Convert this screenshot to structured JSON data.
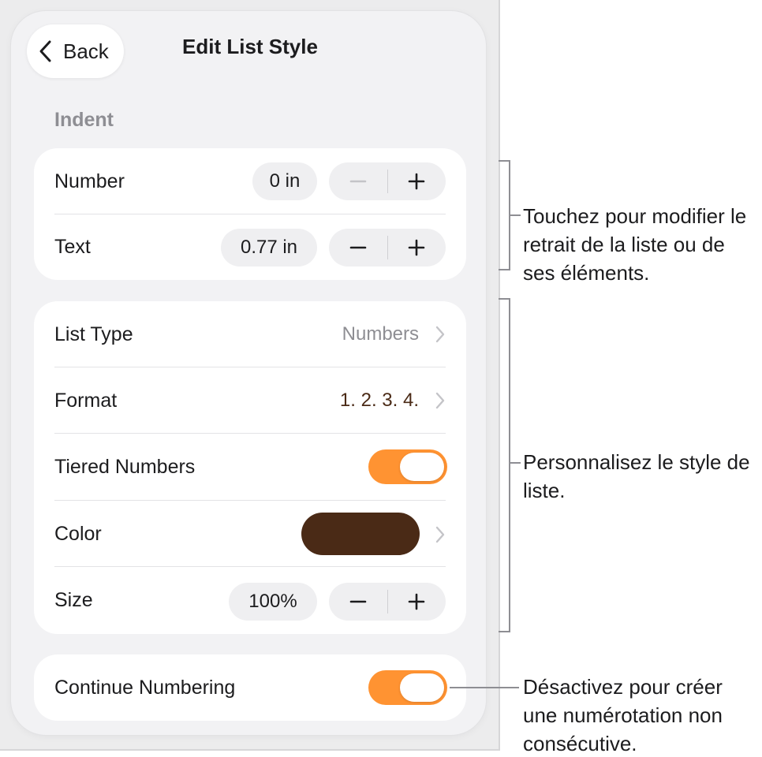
{
  "nav": {
    "back_label": "Back",
    "title": "Edit List Style"
  },
  "indent": {
    "header": "Indent",
    "number": {
      "label": "Number",
      "value": "0 in",
      "minus_enabled": false
    },
    "text": {
      "label": "Text",
      "value": "0.77 in",
      "minus_enabled": true
    }
  },
  "style": {
    "list_type": {
      "label": "List Type",
      "value": "Numbers"
    },
    "format": {
      "label": "Format",
      "value": "1. 2. 3. 4."
    },
    "tiered": {
      "label": "Tiered Numbers",
      "on": true
    },
    "color": {
      "label": "Color",
      "swatch": "#4a2a16"
    },
    "size": {
      "label": "Size",
      "value": "100%"
    }
  },
  "continue_numbering": {
    "label": "Continue Numbering",
    "on": true
  },
  "callouts": {
    "indent": "Touchez pour modifier le retrait de la liste ou de ses éléments.",
    "style": "Personnalisez le style de liste.",
    "continue": "Désactivez pour créer une numérotation non consécutive."
  },
  "colors": {
    "toggle_on": "#ff9332",
    "format_text": "#4a2a16",
    "secondary_text": "#8e8e93"
  }
}
